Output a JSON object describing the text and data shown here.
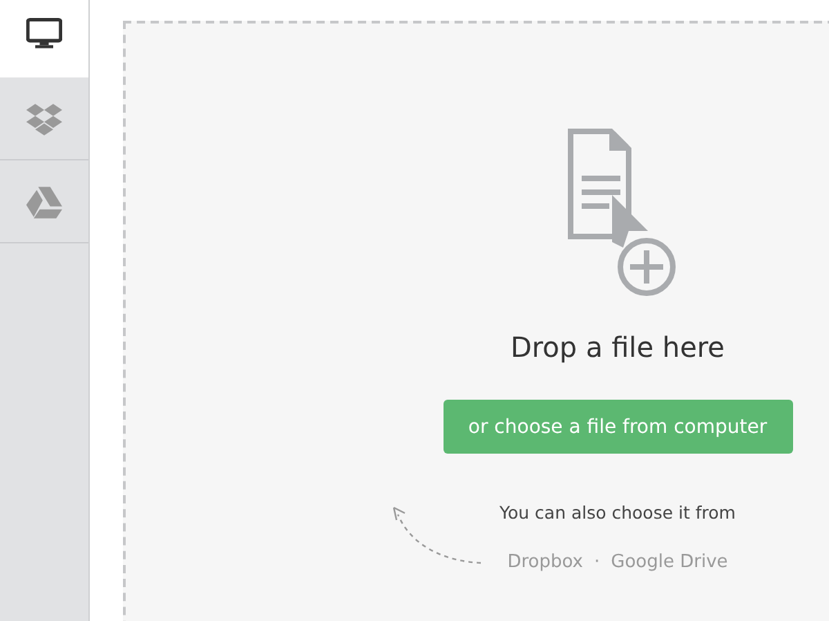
{
  "sidebar": {
    "tabs": [
      {
        "kind": "computer",
        "selected": true
      },
      {
        "kind": "dropbox",
        "selected": false
      },
      {
        "kind": "drive",
        "selected": false
      }
    ]
  },
  "dropzone": {
    "title": "Drop a file here",
    "button": "or choose a file from computer",
    "hint": "You can also choose it from",
    "sources": [
      "Dropbox",
      "Google Drive"
    ],
    "separator": "·"
  }
}
